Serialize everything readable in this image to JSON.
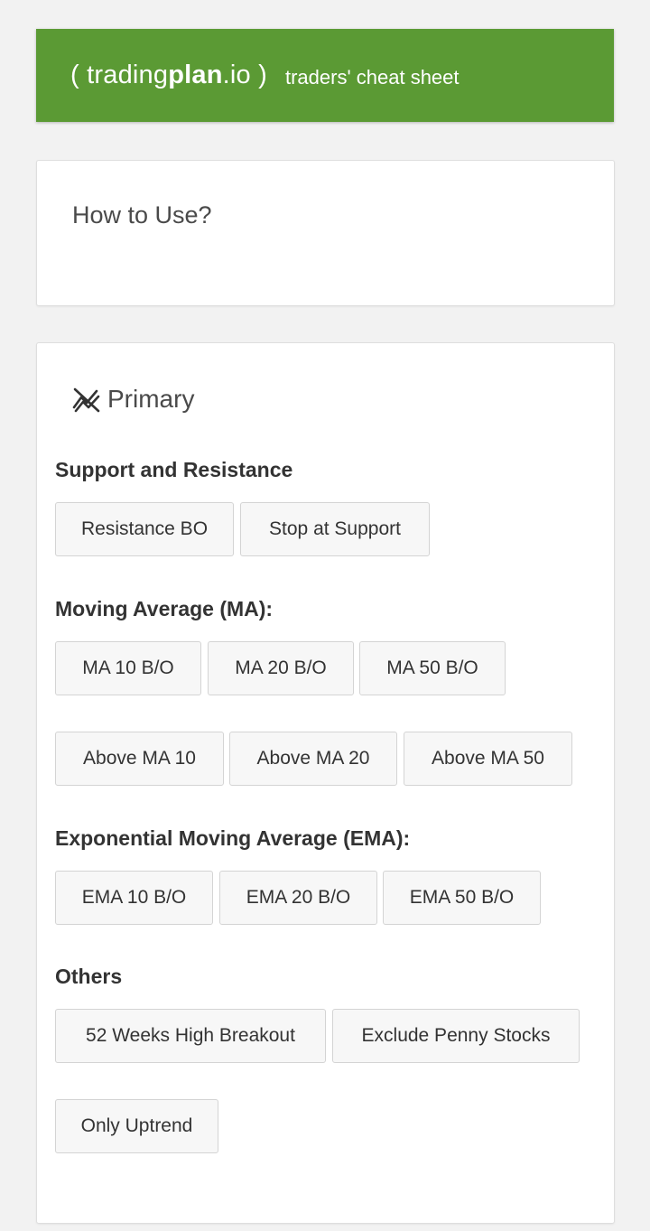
{
  "header": {
    "brand_open": "(",
    "brand_light": "trading",
    "brand_bold": "plan",
    "brand_suffix": ".io",
    "brand_close": ")",
    "tagline": "traders' cheat sheet",
    "color": "#5b9a34"
  },
  "how_to_use": {
    "title": "How to Use?"
  },
  "primary": {
    "title": "Primary",
    "icon": "trending-chart-icon",
    "sections": {
      "support_resistance": {
        "label": "Support and Resistance",
        "buttons": [
          "Resistance BO",
          "Stop at Support"
        ]
      },
      "moving_average": {
        "label": "Moving Average (MA):",
        "buttons": [
          "MA 10 B/O",
          "MA 20 B/O",
          "MA 50 B/O",
          "Above MA 10",
          "Above MA 20",
          "Above MA 50"
        ]
      },
      "ema": {
        "label": "Exponential Moving Average (EMA):",
        "buttons": [
          "EMA 10 B/O",
          "EMA 20 B/O",
          "EMA 50 B/O"
        ]
      },
      "others": {
        "label": "Others",
        "buttons": [
          "52 Weeks High Breakout",
          "Exclude Penny Stocks",
          "Only Uptrend"
        ]
      }
    }
  }
}
